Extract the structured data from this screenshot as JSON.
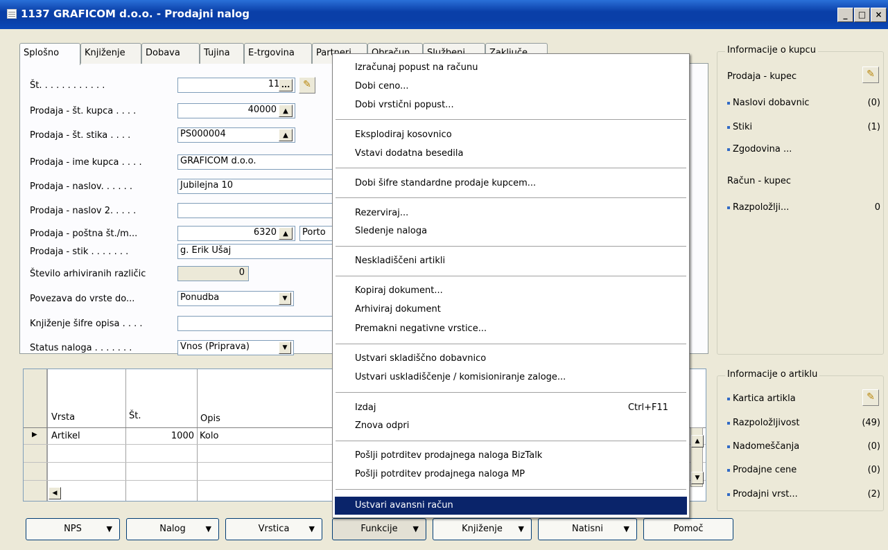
{
  "window": {
    "title": "1137 GRAFICOM d.o.o. - Prodajni nalog",
    "min": "_",
    "max": "□",
    "close": "×"
  },
  "tabs": [
    "Splošno",
    "Knjiženje",
    "Dobava",
    "Tujina",
    "E-trgovina",
    "Partneri",
    "Obračun",
    "Službeni ...",
    "Zaključe..."
  ],
  "fields": [
    {
      "label": "Št. . . . . . . . . . . .",
      "value": "1137"
    },
    {
      "label": "Prodaja - št. kupca . . . .",
      "value": "40000"
    },
    {
      "label": "Prodaja - št. stika . . . .",
      "value": "PS000004"
    },
    {
      "label": "Prodaja - ime kupca . . . .",
      "value": "GRAFICOM d.o.o."
    },
    {
      "label": "Prodaja - naslov. . . . . .",
      "value": "Jubilejna 10"
    },
    {
      "label": "Prodaja - naslov 2. . . . .",
      "value": ""
    },
    {
      "label": "Prodaja - poštna št./m...",
      "value": "6320",
      "city": "Porto"
    },
    {
      "label": "Prodaja - stik . . . . . . .",
      "value": "g. Erik Ušaj"
    },
    {
      "label": "Število arhiviranih različic",
      "value": "0"
    },
    {
      "label": "Povezava do vrste do...",
      "value": "Ponudba"
    },
    {
      "label": "Knjiženje šifre opisa . . . .",
      "value": ""
    },
    {
      "label": "Status naloga . . . . . . .",
      "value": "Vnos (Priprava)"
    }
  ],
  "lines": {
    "headers": [
      "Vrsta",
      "Št.",
      "Opis"
    ],
    "rows": [
      {
        "vrsta": "Artikel",
        "st": "1000",
        "opis": "Kolo"
      }
    ]
  },
  "bottom_buttons": [
    "NPS",
    "Nalog",
    "Vrstica",
    "Funkcije",
    "Knjiženje",
    "Natisni",
    "Pomoč"
  ],
  "menu": {
    "groups": [
      [
        "Izračunaj popust na računu",
        "Dobi ceno...",
        "Dobi vrstični popust..."
      ],
      [
        "Eksplodiraj kosovnico",
        "Vstavi dodatna besedila"
      ],
      [
        "Dobi šifre standardne prodaje kupcem..."
      ],
      [
        "Rezerviraj...",
        "Sledenje naloga"
      ],
      [
        "Neskladiščeni artikli"
      ],
      [
        "Kopiraj dokument...",
        "Arhiviraj dokument",
        "Premakni negativne vrstice..."
      ],
      [
        "Ustvari skladiščno dobavnico",
        "Ustvari uskladiščenje / komisioniranje zaloge..."
      ],
      [
        "Izdaj",
        "Znova odpri"
      ],
      [
        "Pošlji potrditev prodajnega naloga BizTalk",
        "Pošlji potrditev prodajnega naloga MP"
      ],
      [
        "Ustvari avansni račun"
      ]
    ],
    "shortcut_izdaj": "Ctrl+F11"
  },
  "customer_info": {
    "title": "Informacije o kupcu",
    "sales_label": "Prodaja - kupec",
    "items": [
      {
        "label": "Naslovi dobavnic",
        "count": "(0)"
      },
      {
        "label": "Stiki",
        "count": "(1)"
      },
      {
        "label": "Zgodovina ...",
        "count": ""
      }
    ],
    "invoice_label": "Račun - kupec",
    "invoice_items": [
      {
        "label": "Razpoložlji...",
        "count": "0"
      }
    ]
  },
  "item_info": {
    "title": "Informacije o artiklu",
    "items": [
      {
        "label": "Kartica artikla",
        "count": ""
      },
      {
        "label": "Razpoložljivost",
        "count": "(49)"
      },
      {
        "label": "Nadomeščanja",
        "count": "(0)"
      },
      {
        "label": "Prodajne cene",
        "count": "(0)"
      },
      {
        "label": "Prodajni vrst...",
        "count": "(2)"
      }
    ]
  },
  "colors": {
    "title_bar": "#0a3fa8",
    "highlight": "#0a246a",
    "face": "#ece9d8"
  }
}
